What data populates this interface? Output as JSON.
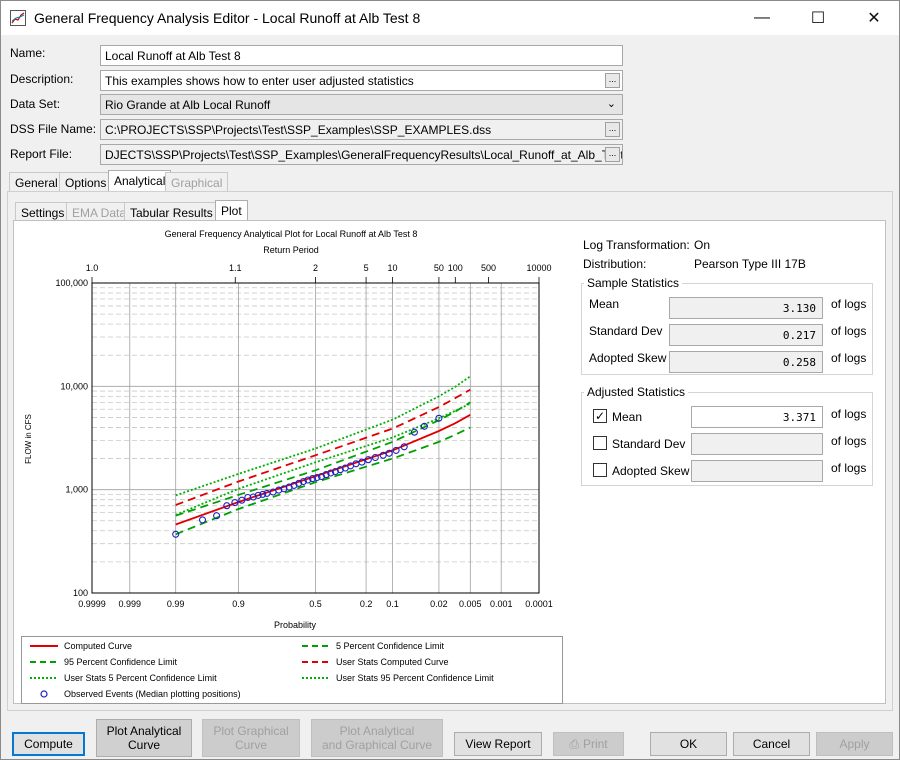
{
  "window": {
    "title": "General Frequency Analysis Editor - Local Runoff at Alb Test 8"
  },
  "form": {
    "name_label": "Name:",
    "name_value": "Local Runoff at Alb Test 8",
    "description_label": "Description:",
    "description_value": "This examples shows how to enter user adjusted statistics",
    "dataset_label": "Data Set:",
    "dataset_value": "Rio Grande at Alb Local Runoff",
    "dss_label": "DSS File Name:",
    "dss_value": "C:\\PROJECTS\\SSP\\Projects\\Test\\SSP_Examples\\SSP_EXAMPLES.dss",
    "report_label": "Report File:",
    "report_value": "DJECTS\\SSP\\Projects\\Test\\SSP_Examples\\GeneralFrequencyResults\\Local_Runoff_at_Alb_Test_8\\",
    "browse_glyph": "..."
  },
  "tabs": [
    {
      "label": "General"
    },
    {
      "label": "Options"
    },
    {
      "label": "Analytical"
    },
    {
      "label": "Graphical"
    }
  ],
  "subtabs": [
    {
      "label": "Settings"
    },
    {
      "label": "EMA Data"
    },
    {
      "label": "Tabular Results"
    },
    {
      "label": "Plot"
    }
  ],
  "plot": {
    "title": "General Frequency Analytical Plot for Local Runoff at Alb Test 8",
    "top_axis_label": "Return Period",
    "x_label": "Probability",
    "y_label": "FLOW in CFS"
  },
  "chart_data": {
    "type": "line",
    "title": "General Frequency Analytical Plot for Local Runoff at Alb Test 8",
    "xlabel": "Probability",
    "ylabel": "FLOW in CFS",
    "x2label": "Return Period",
    "y_scale": "log",
    "x_scale": "normal-probability (exceedance)",
    "ylim": [
      100,
      100000
    ],
    "xlim": [
      0.9999,
      0.0001
    ],
    "x_ticks": [
      "0.9999",
      "0.999",
      "0.99",
      "0.9",
      "0.5",
      "0.2",
      "0.1",
      "0.02",
      "0.005",
      "0.001",
      "0.0001"
    ],
    "x_tick_values": [
      0.9999,
      0.999,
      0.99,
      0.9,
      0.5,
      0.2,
      0.1,
      0.02,
      0.005,
      0.001,
      0.0001
    ],
    "x2_ticks": [
      "1.0",
      "1.1",
      "2",
      "5",
      "10",
      "50",
      "100",
      "500",
      "10000"
    ],
    "x2_tick_values": [
      1.0001,
      1.1,
      2,
      5,
      10,
      50,
      100,
      500,
      10000
    ],
    "y_ticks": [
      "100",
      "1,000",
      "10,000",
      "100,000"
    ],
    "y_tick_values": [
      100,
      1000,
      10000,
      100000
    ],
    "x": [
      0.99,
      0.9,
      0.5,
      0.1,
      0.02,
      0.01,
      0.005
    ],
    "series": [
      {
        "name": "Computed Curve",
        "color": "#e00000",
        "dash": "solid",
        "values": [
          460,
          760,
          1350,
          2400,
          3700,
          4400,
          5300
        ]
      },
      {
        "name": "5 Percent Confidence Limit",
        "color": "#00a000",
        "dash": "dashed",
        "values": [
          560,
          890,
          1540,
          2900,
          4700,
          5700,
          7000
        ]
      },
      {
        "name": "95 Percent Confidence Limit",
        "color": "#00a000",
        "dash": "dashed",
        "values": [
          370,
          650,
          1180,
          2000,
          2900,
          3400,
          4000
        ]
      },
      {
        "name": "User Stats Computed Curve",
        "color": "#e00000",
        "dash": "dashed",
        "values": [
          710,
          1200,
          2150,
          3900,
          6300,
          7700,
          9300
        ]
      },
      {
        "name": "User Stats 5 Percent Confidence Limit",
        "color": "#00b000",
        "dash": "dotted",
        "values": [
          880,
          1420,
          2500,
          4750,
          8000,
          9900,
          12500
        ]
      },
      {
        "name": "User Stats 95 Percent Confidence Limit",
        "color": "#00b000",
        "dash": "dotted",
        "values": [
          570,
          1020,
          1840,
          3200,
          4900,
          5800,
          6800
        ]
      }
    ],
    "observed": {
      "name": "Observed Events (Median plotting positions)",
      "color": "#2020c0",
      "x": [
        0.99,
        0.97,
        0.95,
        0.93,
        0.91,
        0.89,
        0.87,
        0.85,
        0.83,
        0.81,
        0.79,
        0.76,
        0.73,
        0.7,
        0.67,
        0.64,
        0.61,
        0.58,
        0.55,
        0.52,
        0.49,
        0.46,
        0.43,
        0.4,
        0.37,
        0.34,
        0.31,
        0.28,
        0.25,
        0.22,
        0.19,
        0.16,
        0.13,
        0.11,
        0.09,
        0.07,
        0.05,
        0.035,
        0.02
      ],
      "y": [
        370,
        510,
        560,
        700,
        750,
        790,
        840,
        850,
        880,
        900,
        920,
        950,
        990,
        1020,
        1060,
        1100,
        1150,
        1200,
        1240,
        1280,
        1310,
        1340,
        1400,
        1450,
        1500,
        1560,
        1620,
        1700,
        1780,
        1850,
        1950,
        2050,
        2150,
        2250,
        2400,
        2600,
        3600,
        4100,
        4900
      ]
    },
    "grid": true,
    "legend_placement": "bottom"
  },
  "stats": {
    "log_label": "Log Transformation:",
    "log_value": "On",
    "dist_label": "Distribution:",
    "dist_value": "Pearson Type III 17B",
    "sample_title": "Sample Statistics",
    "mean_label": "Mean",
    "mean_value": "3.130",
    "std_label": "Standard Dev",
    "std_value": "0.217",
    "skew_label": "Adopted Skew",
    "skew_value": "0.258",
    "units": "of logs",
    "adjusted_title": "Adjusted Statistics",
    "adj_mean_label": "Mean",
    "adj_mean_value": "3.371",
    "adj_mean_checked": "✓",
    "adj_std_label": "Standard Dev",
    "adj_std_value": "",
    "adj_skew_label": "Adopted Skew",
    "adj_skew_value": ""
  },
  "buttons": {
    "compute": "Compute",
    "plot_analytical_1": "Plot Analytical",
    "plot_analytical_2": "Curve",
    "plot_graphical_1": "Plot Graphical",
    "plot_graphical_2": "Curve",
    "plot_both_1": "Plot Analytical",
    "plot_both_2": "and Graphical Curve",
    "view_report": "View Report",
    "print": "Print",
    "ok": "OK",
    "cancel": "Cancel",
    "apply": "Apply"
  },
  "colors": {
    "accent": "#0078d7",
    "computed": "#e00000",
    "confidence": "#00a000",
    "observed": "#2020c0"
  }
}
